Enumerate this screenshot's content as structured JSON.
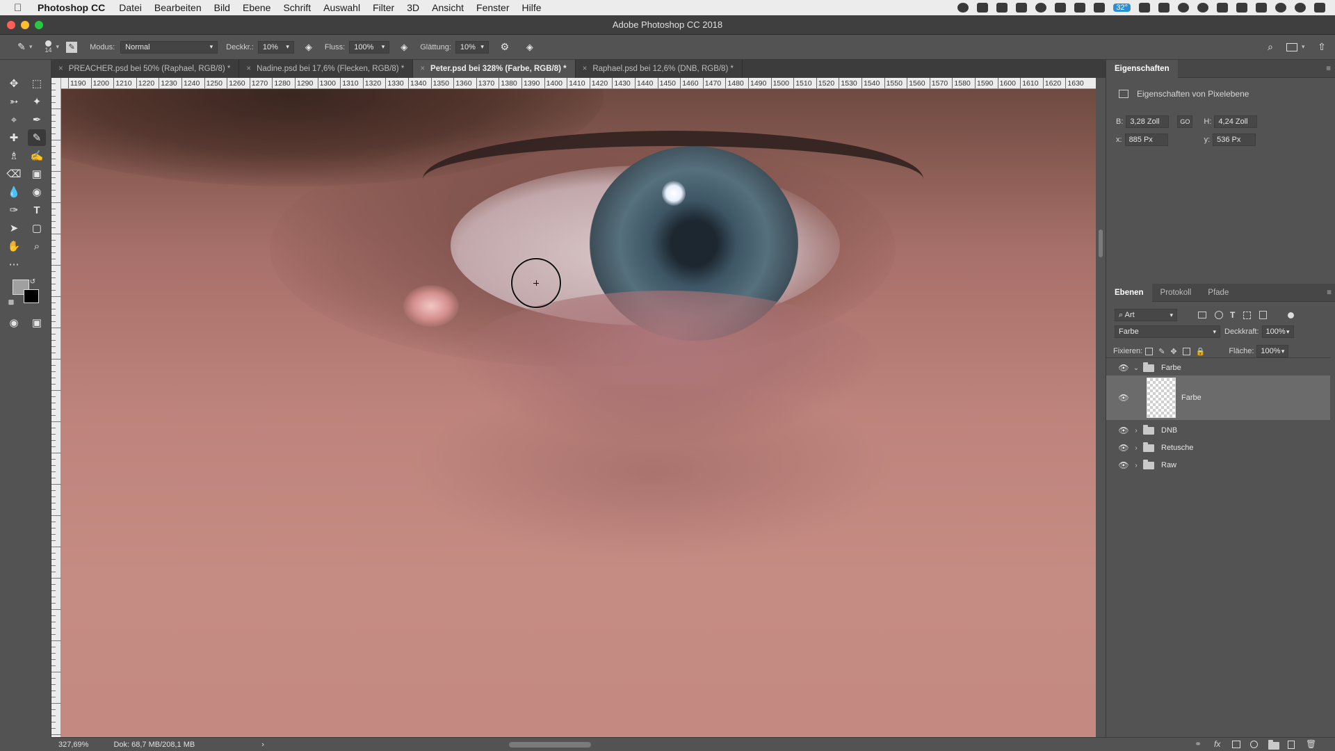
{
  "menubar": {
    "app_name": "Photoshop CC",
    "menus": [
      "Datei",
      "Bearbeiten",
      "Bild",
      "Ebene",
      "Schrift",
      "Auswahl",
      "Filter",
      "3D",
      "Ansicht",
      "Fenster",
      "Hilfe"
    ],
    "battery_badge": "32°"
  },
  "window": {
    "title": "Adobe Photoshop CC 2018"
  },
  "options": {
    "brush_size": "14",
    "mode_label": "Modus:",
    "mode_value": "Normal",
    "opacity_label": "Deckkr.:",
    "opacity_value": "10%",
    "flow_label": "Fluss:",
    "flow_value": "100%",
    "smoothing_label": "Glättung:",
    "smoothing_value": "10%"
  },
  "tabs": [
    {
      "label": "PREACHER.psd bei 50% (Raphael, RGB/8) *",
      "active": false
    },
    {
      "label": "Nadine.psd bei 17,6% (Flecken, RGB/8) *",
      "active": false
    },
    {
      "label": "Peter.psd bei 328% (Farbe, RGB/8) *",
      "active": true
    },
    {
      "label": "Raphael.psd bei 12,6% (DNB, RGB/8) *",
      "active": false
    }
  ],
  "ruler": {
    "labels": [
      "1190",
      "1200",
      "1210",
      "1220",
      "1230",
      "1240",
      "1250",
      "1260",
      "1270",
      "1280",
      "1290",
      "1300",
      "1310",
      "1320",
      "1330",
      "1340",
      "1350",
      "1360",
      "1370",
      "1380",
      "1390",
      "1400",
      "1410",
      "1420",
      "1430",
      "1440",
      "1450",
      "1460",
      "1470",
      "1480",
      "1490",
      "1500",
      "1510",
      "1520",
      "1530",
      "1540",
      "1550",
      "1560",
      "1570",
      "1580",
      "1590",
      "1600",
      "1610",
      "1620",
      "1630"
    ]
  },
  "status": {
    "zoom": "327,69%",
    "doc": "Dok: 68,7 MB/208,1 MB",
    "arrow": "›"
  },
  "properties": {
    "tab": "Eigenschaften",
    "subtitle": "Eigenschaften von Pixelebene",
    "w_label": "B:",
    "w_value": "3,28 Zoll",
    "link": "GO",
    "h_label": "H:",
    "h_value": "4,24 Zoll",
    "x_label": "x:",
    "x_value": "885 Px",
    "y_label": "y:",
    "y_value": "536 Px"
  },
  "layers": {
    "tabs": [
      "Ebenen",
      "Protokoll",
      "Pfade"
    ],
    "filter_kind": "Art",
    "blend_mode": "Farbe",
    "opacity_label": "Deckkraft:",
    "opacity_value": "100%",
    "lock_label": "Fixieren:",
    "fill_label": "Fläche:",
    "fill_value": "100%",
    "items": [
      {
        "name": "Farbe",
        "type": "group",
        "expanded": true
      },
      {
        "name": "Farbe",
        "type": "pixel",
        "selected": true
      },
      {
        "name": "DNB",
        "type": "group",
        "expanded": false
      },
      {
        "name": "Retusche",
        "type": "group",
        "expanded": false
      },
      {
        "name": "Raw",
        "type": "group",
        "expanded": false
      }
    ]
  },
  "colors": {
    "foreground": "#a0a0a0",
    "background": "#000000",
    "accent": "#2a8fd6"
  }
}
